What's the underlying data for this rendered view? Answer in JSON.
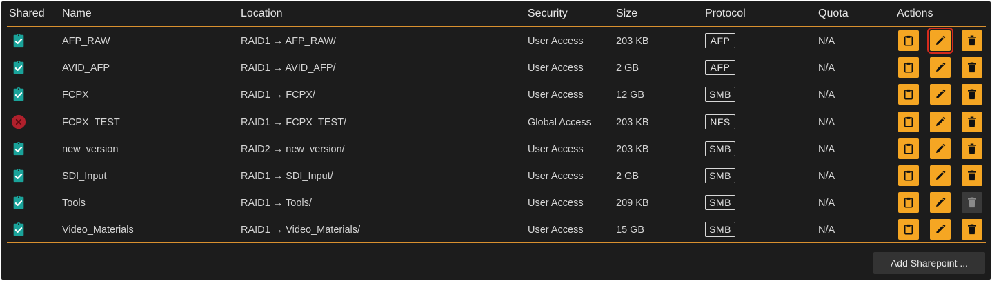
{
  "headers": {
    "shared": "Shared",
    "name": "Name",
    "location": "Location",
    "security": "Security",
    "size": "Size",
    "protocol": "Protocol",
    "quota": "Quota",
    "actions": "Actions"
  },
  "rows": [
    {
      "shared": "yes",
      "name": "AFP_RAW",
      "location": "RAID1 → AFP_RAW/",
      "security": "User Access",
      "size": "203 KB",
      "protocol": "AFP",
      "quota": "N/A",
      "delete_enabled": true,
      "edit_highlighted": true
    },
    {
      "shared": "yes",
      "name": "AVID_AFP",
      "location": "RAID1 → AVID_AFP/",
      "security": "User Access",
      "size": "2 GB",
      "protocol": "AFP",
      "quota": "N/A",
      "delete_enabled": true,
      "edit_highlighted": false
    },
    {
      "shared": "yes",
      "name": "FCPX",
      "location": "RAID1 → FCPX/",
      "security": "User Access",
      "size": "12 GB",
      "protocol": "SMB",
      "quota": "N/A",
      "delete_enabled": true,
      "edit_highlighted": false
    },
    {
      "shared": "no",
      "name": "FCPX_TEST",
      "location": "RAID1 → FCPX_TEST/",
      "security": "Global Access",
      "size": "203 KB",
      "protocol": "NFS",
      "quota": "N/A",
      "delete_enabled": true,
      "edit_highlighted": false
    },
    {
      "shared": "yes",
      "name": "new_version",
      "location": "RAID2 → new_version/",
      "security": "User Access",
      "size": "203 KB",
      "protocol": "SMB",
      "quota": "N/A",
      "delete_enabled": true,
      "edit_highlighted": false
    },
    {
      "shared": "yes",
      "name": "SDI_Input",
      "location": "RAID1 → SDI_Input/",
      "security": "User Access",
      "size": "2 GB",
      "protocol": "SMB",
      "quota": "N/A",
      "delete_enabled": true,
      "edit_highlighted": false
    },
    {
      "shared": "yes",
      "name": "Tools",
      "location": "RAID1 → Tools/",
      "security": "User Access",
      "size": "209 KB",
      "protocol": "SMB",
      "quota": "N/A",
      "delete_enabled": false,
      "edit_highlighted": false
    },
    {
      "shared": "yes",
      "name": "Video_Materials",
      "location": "RAID1 → Video_Materials/",
      "security": "User Access",
      "size": "15 GB",
      "protocol": "SMB",
      "quota": "N/A",
      "delete_enabled": true,
      "edit_highlighted": false
    }
  ],
  "icons": {
    "shared_yes": "clipboard-check-icon",
    "shared_no": "circle-x-icon",
    "action_1": "clipboard-icon",
    "action_2": "pencil-icon",
    "action_3": "trash-icon"
  },
  "colors": {
    "background": "#1c1c1c",
    "accent": "#f5a623",
    "divider": "#d9902f",
    "shared_ok": "#1aa39a",
    "shared_off": "#b0202c",
    "disabled_button": "#3a3a3a",
    "highlight": "#d62a1d"
  },
  "add_button": {
    "label": "Add Sharepoint ..."
  }
}
